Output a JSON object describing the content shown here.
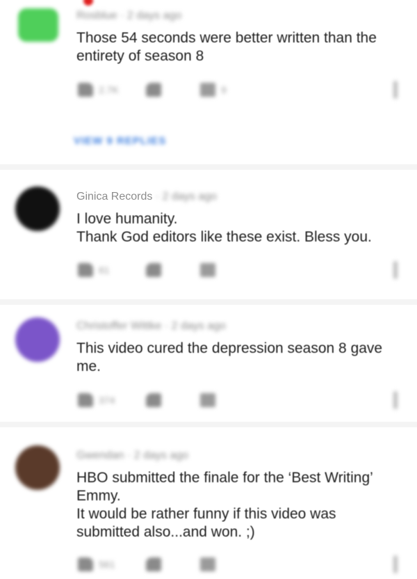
{
  "comments": [
    {
      "author": "Rosblue",
      "time": "· 2 days ago",
      "text": "Those 54 seconds were better written than the entirety of season 8",
      "likes": "2.7K",
      "replies_count": "9",
      "view_replies": "VIEW 9 REPLIES",
      "avatar_color": "#4fcf5a"
    },
    {
      "author": "Ginica Records",
      "time": "· 2 days ago",
      "text": "I love humanity.\nThank God editors like these exist. Bless you.",
      "likes": "61",
      "avatar_color": "#111111"
    },
    {
      "author": "Christoffer Wittke",
      "time": "· 2 days ago",
      "text": "This video cured the depression season 8 gave me.",
      "likes": "374",
      "avatar_color": "#7b55c9"
    },
    {
      "author": "Gwendan",
      "time": "· 2 days ago",
      "text": "HBO submitted the finale for the ‘Best Writing’ Emmy.\nIt would be rather funny if this video was submitted also...and won.  ;)",
      "likes": "561",
      "avatar_color": "#5a3a2a"
    }
  ],
  "colors": {
    "link": "#3d7fe0",
    "separator": "#f4f4f4"
  },
  "icons": [
    "thumb-up-icon",
    "thumb-down-icon",
    "reply-icon",
    "more-vert-icon"
  ]
}
